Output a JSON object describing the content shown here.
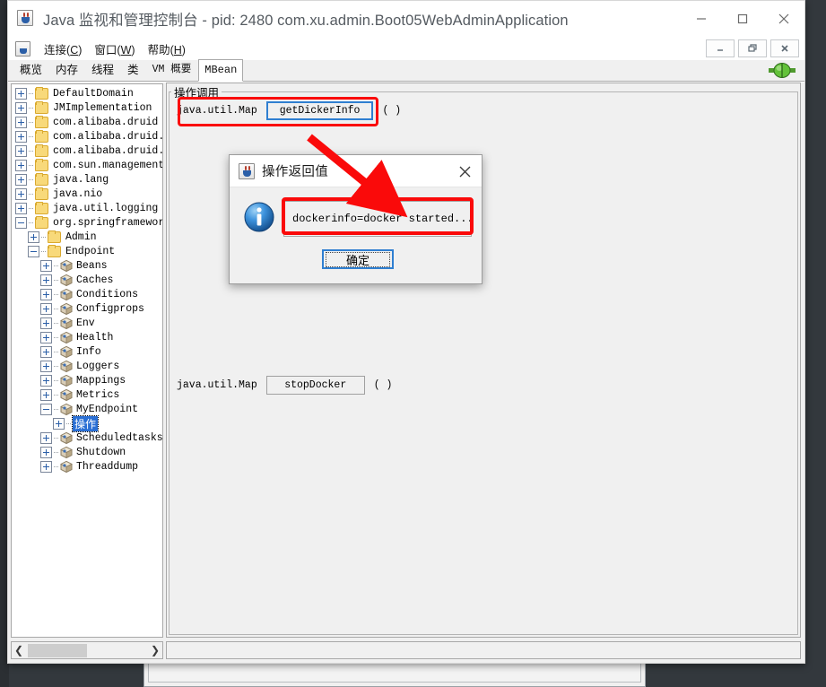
{
  "window": {
    "title": "Java 监视和管理控制台 - pid: 2480 com.xu.admin.Boot05WebAdminApplication",
    "app_icon": "java-cup-icon",
    "minimize_label": "—",
    "maximize_label": "□",
    "close_label": "✕"
  },
  "menubar": {
    "icon": "java-cup-icon",
    "items": [
      {
        "text": "连接",
        "mnemonic": "C"
      },
      {
        "text": "窗口",
        "mnemonic": "W"
      },
      {
        "text": "帮助",
        "mnemonic": "H"
      }
    ],
    "mdi_buttons": [
      {
        "name": "mdi-minimize",
        "glyph": "_"
      },
      {
        "name": "mdi-restore",
        "glyph": "❐"
      },
      {
        "name": "mdi-close",
        "glyph": "✖"
      }
    ]
  },
  "tabs": [
    {
      "label": "概览",
      "selected": false,
      "mono": false
    },
    {
      "label": "内存",
      "selected": false,
      "mono": false
    },
    {
      "label": "线程",
      "selected": false,
      "mono": false
    },
    {
      "label": "类",
      "selected": false,
      "mono": false
    },
    {
      "label": "VM 概要",
      "selected": false,
      "mono": true
    },
    {
      "label": "MBean",
      "selected": true,
      "mono": true
    }
  ],
  "connection_indicator": {
    "name": "connected-plug-icon",
    "color": "#4caf2a",
    "state": "connected"
  },
  "tree": {
    "nodes": [
      {
        "label": "DefaultDomain",
        "indent": 0,
        "icon": "folder",
        "expander": "plus",
        "selected": false
      },
      {
        "label": "JMImplementation",
        "indent": 0,
        "icon": "folder",
        "expander": "plus",
        "selected": false
      },
      {
        "label": "com.alibaba.druid",
        "indent": 0,
        "icon": "folder",
        "expander": "plus",
        "selected": false
      },
      {
        "label": "com.alibaba.druid.sp",
        "indent": 0,
        "icon": "folder",
        "expander": "plus",
        "selected": false
      },
      {
        "label": "com.alibaba.druid.wa",
        "indent": 0,
        "icon": "folder",
        "expander": "plus",
        "selected": false
      },
      {
        "label": "com.sun.management",
        "indent": 0,
        "icon": "folder",
        "expander": "plus",
        "selected": false
      },
      {
        "label": "java.lang",
        "indent": 0,
        "icon": "folder",
        "expander": "plus",
        "selected": false
      },
      {
        "label": "java.nio",
        "indent": 0,
        "icon": "folder",
        "expander": "plus",
        "selected": false
      },
      {
        "label": "java.util.logging",
        "indent": 0,
        "icon": "folder",
        "expander": "plus",
        "selected": false
      },
      {
        "label": "org.springframework.",
        "indent": 0,
        "icon": "folder",
        "expander": "minus",
        "selected": false
      },
      {
        "label": "Admin",
        "indent": 1,
        "icon": "folder",
        "expander": "plus",
        "selected": false
      },
      {
        "label": "Endpoint",
        "indent": 1,
        "icon": "folder",
        "expander": "minus",
        "selected": false
      },
      {
        "label": "Beans",
        "indent": 2,
        "icon": "mbean",
        "expander": "plus",
        "selected": false
      },
      {
        "label": "Caches",
        "indent": 2,
        "icon": "mbean",
        "expander": "plus",
        "selected": false
      },
      {
        "label": "Conditions",
        "indent": 2,
        "icon": "mbean",
        "expander": "plus",
        "selected": false
      },
      {
        "label": "Configprops",
        "indent": 2,
        "icon": "mbean",
        "expander": "plus",
        "selected": false
      },
      {
        "label": "Env",
        "indent": 2,
        "icon": "mbean",
        "expander": "plus",
        "selected": false
      },
      {
        "label": "Health",
        "indent": 2,
        "icon": "mbean",
        "expander": "plus",
        "selected": false
      },
      {
        "label": "Info",
        "indent": 2,
        "icon": "mbean",
        "expander": "plus",
        "selected": false
      },
      {
        "label": "Loggers",
        "indent": 2,
        "icon": "mbean",
        "expander": "plus",
        "selected": false
      },
      {
        "label": "Mappings",
        "indent": 2,
        "icon": "mbean",
        "expander": "plus",
        "selected": false
      },
      {
        "label": "Metrics",
        "indent": 2,
        "icon": "mbean",
        "expander": "plus",
        "selected": false
      },
      {
        "label": "MyEndpoint",
        "indent": 2,
        "icon": "mbean",
        "expander": "minus",
        "selected": false
      },
      {
        "label": "操作",
        "indent": 3,
        "icon": "none",
        "expander": "plus",
        "selected": true
      },
      {
        "label": "Scheduledtasks",
        "indent": 2,
        "icon": "mbean",
        "expander": "plus",
        "selected": false
      },
      {
        "label": "Shutdown",
        "indent": 2,
        "icon": "mbean",
        "expander": "plus",
        "selected": false
      },
      {
        "label": "Threaddump",
        "indent": 2,
        "icon": "mbean",
        "expander": "plus",
        "selected": false
      }
    ],
    "hscroll": {
      "left_arrow": "❮",
      "right_arrow": "❯"
    }
  },
  "operations_panel": {
    "legend": "操作调用",
    "rows": [
      {
        "return_type": "java.util.Map",
        "name": "getDickerInfo",
        "args": "( )",
        "focused": true
      },
      {
        "return_type": "java.util.Map",
        "name": "stopDocker",
        "args": "( )",
        "focused": false
      }
    ],
    "hscroll": {
      "left_arrow": "❮",
      "right_arrow": "❯"
    }
  },
  "dialog": {
    "icon": "java-cup-icon",
    "title": "操作返回值",
    "close_label": "✕",
    "info_icon": "information-icon",
    "value": "dockerinfo=docker started...",
    "ok_label": "确定"
  },
  "annotations": {
    "accent_color": "#fa0a0a",
    "highlight_operation": "getDickerInfo invocation row",
    "highlight_value": "returned value field",
    "arrow": "points from operation row to returned value field"
  }
}
